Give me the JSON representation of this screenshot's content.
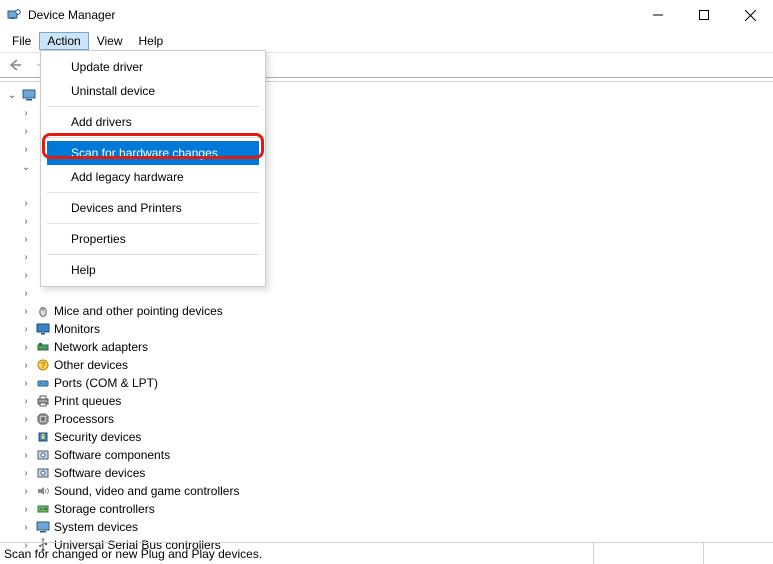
{
  "window": {
    "title": "Device Manager"
  },
  "menubar": {
    "items": [
      {
        "label": "File"
      },
      {
        "label": "Action"
      },
      {
        "label": "View"
      },
      {
        "label": "Help"
      }
    ],
    "active_index": 1
  },
  "action_menu": {
    "items": [
      {
        "label": "Update driver"
      },
      {
        "label": "Uninstall device"
      },
      {
        "label": "Add drivers"
      },
      {
        "label": "Scan for hardware changes",
        "highlighted": true
      },
      {
        "label": "Add legacy hardware"
      },
      {
        "label": "Devices and Printers"
      },
      {
        "label": "Properties"
      },
      {
        "label": "Help"
      }
    ]
  },
  "tree": {
    "root": {
      "expanded": true
    },
    "nodes": [
      {
        "label": "",
        "expanded": true
      },
      {
        "label": "",
        "expanded": false
      },
      {
        "label": "",
        "expanded": false
      },
      {
        "label": "",
        "expanded": false
      },
      {
        "label": "",
        "expanded": true
      },
      {
        "label": "",
        "expanded": false
      },
      {
        "label": "",
        "expanded": false
      },
      {
        "label": "",
        "expanded": false
      },
      {
        "label": "",
        "expanded": false
      },
      {
        "label": "",
        "expanded": false
      },
      {
        "label": "",
        "expanded": false
      },
      {
        "label": "",
        "expanded": false
      },
      {
        "label": "Mice and other pointing devices",
        "expanded": false,
        "icon": "mouse"
      },
      {
        "label": "Monitors",
        "expanded": false,
        "icon": "monitor"
      },
      {
        "label": "Network adapters",
        "expanded": false,
        "icon": "network"
      },
      {
        "label": "Other devices",
        "expanded": false,
        "icon": "other"
      },
      {
        "label": "Ports (COM & LPT)",
        "expanded": false,
        "icon": "port"
      },
      {
        "label": "Print queues",
        "expanded": false,
        "icon": "printer"
      },
      {
        "label": "Processors",
        "expanded": false,
        "icon": "cpu"
      },
      {
        "label": "Security devices",
        "expanded": false,
        "icon": "security"
      },
      {
        "label": "Software components",
        "expanded": false,
        "icon": "software"
      },
      {
        "label": "Software devices",
        "expanded": false,
        "icon": "software"
      },
      {
        "label": "Sound, video and game controllers",
        "expanded": false,
        "icon": "sound"
      },
      {
        "label": "Storage controllers",
        "expanded": false,
        "icon": "storage"
      },
      {
        "label": "System devices",
        "expanded": false,
        "icon": "system"
      },
      {
        "label": "Universal Serial Bus controllers",
        "expanded": false,
        "icon": "usb"
      }
    ]
  },
  "statusbar": {
    "text": "Scan for changed or new Plug and Play devices."
  }
}
